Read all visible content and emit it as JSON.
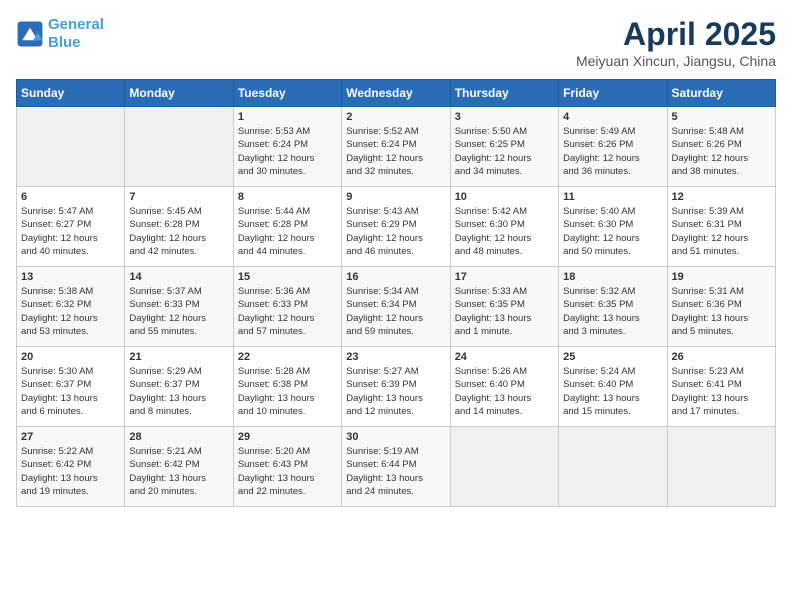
{
  "logo": {
    "line1": "General",
    "line2": "Blue"
  },
  "title": "April 2025",
  "subtitle": "Meiyuan Xincun, Jiangsu, China",
  "weekdays": [
    "Sunday",
    "Monday",
    "Tuesday",
    "Wednesday",
    "Thursday",
    "Friday",
    "Saturday"
  ],
  "weeks": [
    [
      {
        "day": "",
        "info": ""
      },
      {
        "day": "",
        "info": ""
      },
      {
        "day": "1",
        "info": "Sunrise: 5:53 AM\nSunset: 6:24 PM\nDaylight: 12 hours\nand 30 minutes."
      },
      {
        "day": "2",
        "info": "Sunrise: 5:52 AM\nSunset: 6:24 PM\nDaylight: 12 hours\nand 32 minutes."
      },
      {
        "day": "3",
        "info": "Sunrise: 5:50 AM\nSunset: 6:25 PM\nDaylight: 12 hours\nand 34 minutes."
      },
      {
        "day": "4",
        "info": "Sunrise: 5:49 AM\nSunset: 6:26 PM\nDaylight: 12 hours\nand 36 minutes."
      },
      {
        "day": "5",
        "info": "Sunrise: 5:48 AM\nSunset: 6:26 PM\nDaylight: 12 hours\nand 38 minutes."
      }
    ],
    [
      {
        "day": "6",
        "info": "Sunrise: 5:47 AM\nSunset: 6:27 PM\nDaylight: 12 hours\nand 40 minutes."
      },
      {
        "day": "7",
        "info": "Sunrise: 5:45 AM\nSunset: 6:28 PM\nDaylight: 12 hours\nand 42 minutes."
      },
      {
        "day": "8",
        "info": "Sunrise: 5:44 AM\nSunset: 6:28 PM\nDaylight: 12 hours\nand 44 minutes."
      },
      {
        "day": "9",
        "info": "Sunrise: 5:43 AM\nSunset: 6:29 PM\nDaylight: 12 hours\nand 46 minutes."
      },
      {
        "day": "10",
        "info": "Sunrise: 5:42 AM\nSunset: 6:30 PM\nDaylight: 12 hours\nand 48 minutes."
      },
      {
        "day": "11",
        "info": "Sunrise: 5:40 AM\nSunset: 6:30 PM\nDaylight: 12 hours\nand 50 minutes."
      },
      {
        "day": "12",
        "info": "Sunrise: 5:39 AM\nSunset: 6:31 PM\nDaylight: 12 hours\nand 51 minutes."
      }
    ],
    [
      {
        "day": "13",
        "info": "Sunrise: 5:38 AM\nSunset: 6:32 PM\nDaylight: 12 hours\nand 53 minutes."
      },
      {
        "day": "14",
        "info": "Sunrise: 5:37 AM\nSunset: 6:33 PM\nDaylight: 12 hours\nand 55 minutes."
      },
      {
        "day": "15",
        "info": "Sunrise: 5:36 AM\nSunset: 6:33 PM\nDaylight: 12 hours\nand 57 minutes."
      },
      {
        "day": "16",
        "info": "Sunrise: 5:34 AM\nSunset: 6:34 PM\nDaylight: 12 hours\nand 59 minutes."
      },
      {
        "day": "17",
        "info": "Sunrise: 5:33 AM\nSunset: 6:35 PM\nDaylight: 13 hours\nand 1 minute."
      },
      {
        "day": "18",
        "info": "Sunrise: 5:32 AM\nSunset: 6:35 PM\nDaylight: 13 hours\nand 3 minutes."
      },
      {
        "day": "19",
        "info": "Sunrise: 5:31 AM\nSunset: 6:36 PM\nDaylight: 13 hours\nand 5 minutes."
      }
    ],
    [
      {
        "day": "20",
        "info": "Sunrise: 5:30 AM\nSunset: 6:37 PM\nDaylight: 13 hours\nand 6 minutes."
      },
      {
        "day": "21",
        "info": "Sunrise: 5:29 AM\nSunset: 6:37 PM\nDaylight: 13 hours\nand 8 minutes."
      },
      {
        "day": "22",
        "info": "Sunrise: 5:28 AM\nSunset: 6:38 PM\nDaylight: 13 hours\nand 10 minutes."
      },
      {
        "day": "23",
        "info": "Sunrise: 5:27 AM\nSunset: 6:39 PM\nDaylight: 13 hours\nand 12 minutes."
      },
      {
        "day": "24",
        "info": "Sunrise: 5:26 AM\nSunset: 6:40 PM\nDaylight: 13 hours\nand 14 minutes."
      },
      {
        "day": "25",
        "info": "Sunrise: 5:24 AM\nSunset: 6:40 PM\nDaylight: 13 hours\nand 15 minutes."
      },
      {
        "day": "26",
        "info": "Sunrise: 5:23 AM\nSunset: 6:41 PM\nDaylight: 13 hours\nand 17 minutes."
      }
    ],
    [
      {
        "day": "27",
        "info": "Sunrise: 5:22 AM\nSunset: 6:42 PM\nDaylight: 13 hours\nand 19 minutes."
      },
      {
        "day": "28",
        "info": "Sunrise: 5:21 AM\nSunset: 6:42 PM\nDaylight: 13 hours\nand 20 minutes."
      },
      {
        "day": "29",
        "info": "Sunrise: 5:20 AM\nSunset: 6:43 PM\nDaylight: 13 hours\nand 22 minutes."
      },
      {
        "day": "30",
        "info": "Sunrise: 5:19 AM\nSunset: 6:44 PM\nDaylight: 13 hours\nand 24 minutes."
      },
      {
        "day": "",
        "info": ""
      },
      {
        "day": "",
        "info": ""
      },
      {
        "day": "",
        "info": ""
      }
    ]
  ]
}
